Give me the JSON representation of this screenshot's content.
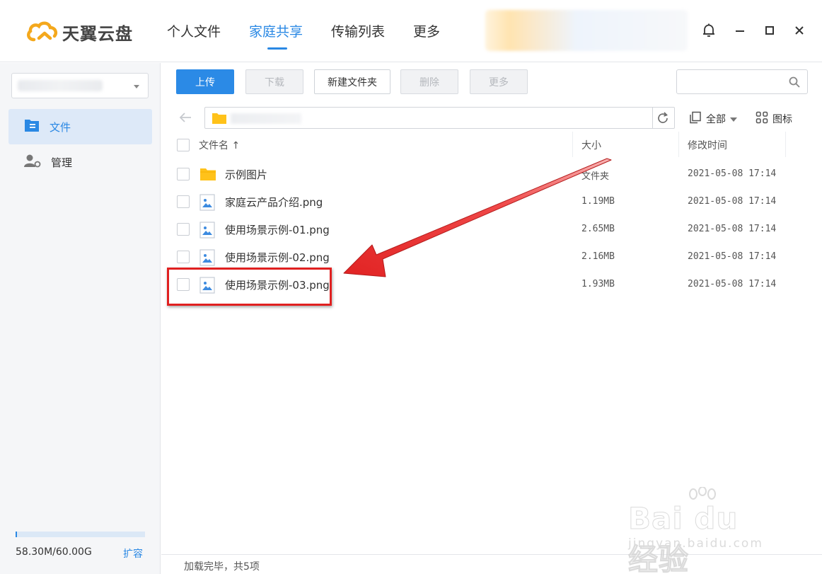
{
  "app": {
    "name": "天翼云盘"
  },
  "nav": {
    "items": [
      {
        "label": "个人文件"
      },
      {
        "label": "家庭共享",
        "active": true
      },
      {
        "label": "传输列表"
      },
      {
        "label": "更多"
      }
    ]
  },
  "sidebar": {
    "items": [
      {
        "label": "文件",
        "icon": "file-icon",
        "active": true
      },
      {
        "label": "管理",
        "icon": "user-manage-icon"
      }
    ],
    "quota": {
      "used_text": "58.30M/60.00G",
      "used_fraction": 0.001,
      "expand_label": "扩容"
    }
  },
  "toolbar": {
    "upload_label": "上传",
    "download_label": "下载",
    "new_folder_label": "新建文件夹",
    "delete_label": "删除",
    "more_label": "更多"
  },
  "search": {
    "placeholder": ""
  },
  "view": {
    "filter_label": "全部",
    "mode_label": "图标"
  },
  "table": {
    "headers": {
      "name": "文件名 ↑",
      "size": "大小",
      "modified": "修改时间"
    },
    "rows": [
      {
        "name": "示例图片",
        "type": "folder",
        "size": "文件夹",
        "modified": "2021-05-08 17:14"
      },
      {
        "name": "家庭云产品介绍.png",
        "type": "image",
        "size": "1.19MB",
        "modified": "2021-05-08 17:14"
      },
      {
        "name": "使用场景示例-01.png",
        "type": "image",
        "size": "2.65MB",
        "modified": "2021-05-08 17:14"
      },
      {
        "name": "使用场景示例-02.png",
        "type": "image",
        "size": "2.16MB",
        "modified": "2021-05-08 17:14"
      },
      {
        "name": "使用场景示例-03.png",
        "type": "image",
        "size": "1.93MB",
        "modified": "2021-05-08 17:14",
        "highlighted": true
      }
    ]
  },
  "status": {
    "text": "加载完毕，共5项"
  },
  "watermark": {
    "brand": "Bai du 经验",
    "url": "jingyan.baidu.com"
  },
  "colors": {
    "accent": "#2a88e4",
    "highlight": "#e02020",
    "folder": "#ffc21a"
  }
}
